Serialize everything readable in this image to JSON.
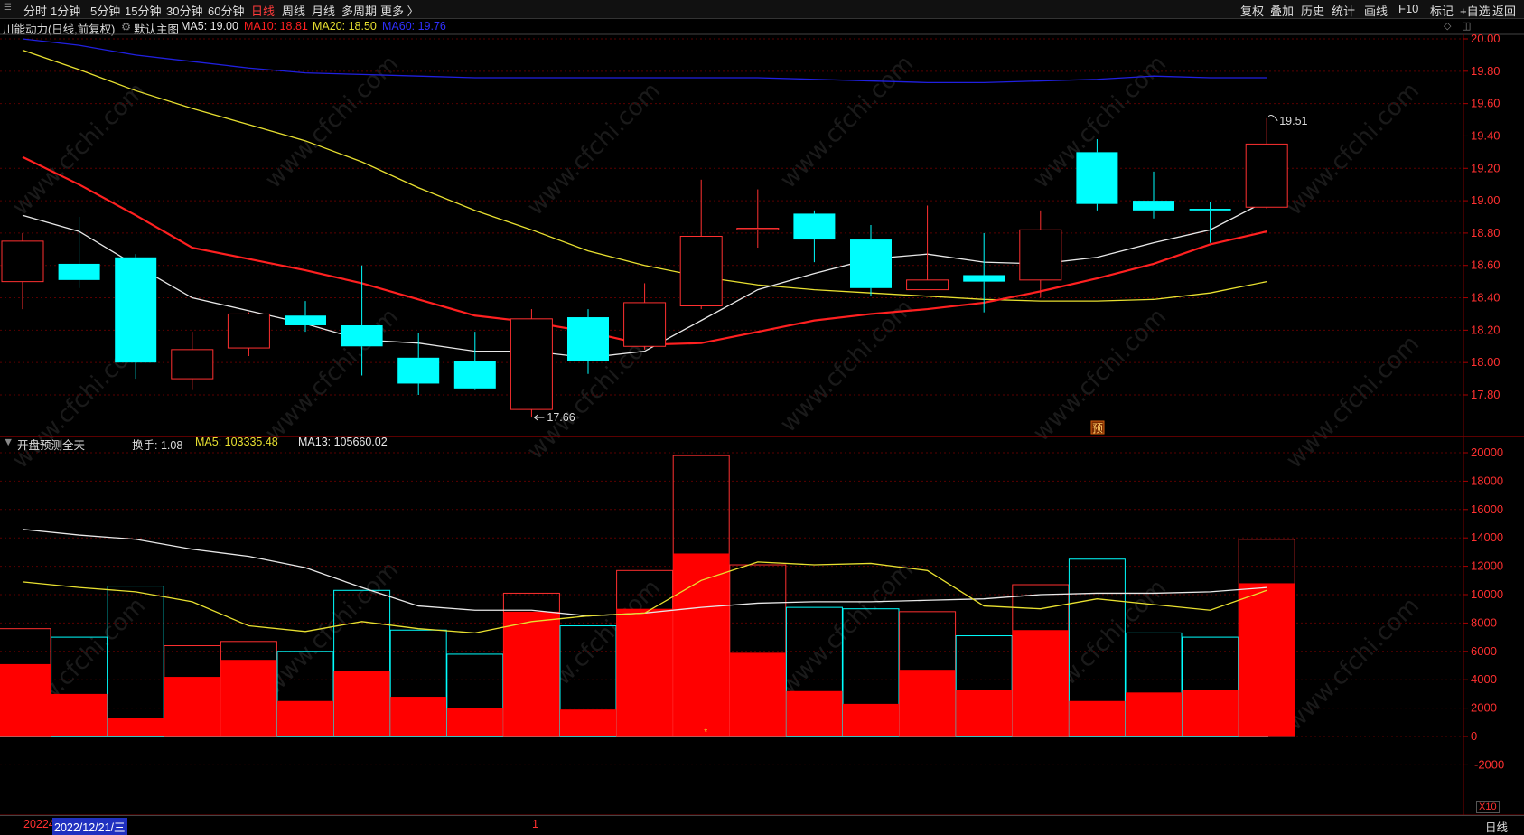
{
  "topbar": {
    "periods": [
      "分时",
      "1分钟",
      "5分钟",
      "15分钟",
      "30分钟",
      "60分钟",
      "日线",
      "周线",
      "月线",
      "多周期",
      "更多 〉"
    ],
    "active_period": "日线",
    "right_buttons": [
      "复权",
      "叠加",
      "历史",
      "统计",
      "画线",
      "F10",
      "标记",
      "+自选",
      "返回"
    ]
  },
  "price_panel": {
    "title": "川能动力(日线,前复权)",
    "main_label": "默认主图",
    "ma5": "MA5: 19.00",
    "ma10": "MA10: 18.81",
    "ma20": "MA20: 18.50",
    "ma60": "MA60: 19.76",
    "high_label": "19.51",
    "low_label": "17.66",
    "forecast_marker": "预"
  },
  "volume_panel": {
    "title": "开盘预测全天",
    "turnover": "换手: 1.08",
    "ma5": "MA5: 103335.48",
    "ma13": "MA13: 105660.02",
    "scale_label": "X10"
  },
  "bottombar": {
    "date_prefix": "20224",
    "date_selected": "2022/12/21/三",
    "marker": "1",
    "period": "日线"
  },
  "watermark": "www.cfchi.com",
  "colors": {
    "up": "#ff3030",
    "down": "#00ffff",
    "ma5": "#e8e8e8",
    "ma10": "#ff2020",
    "ma20": "#e8e030",
    "ma60": "#2020e0",
    "grid": "#5a0000"
  },
  "chart_data": [
    {
      "type": "candlestick",
      "title": "川能动力(日线,前复权)",
      "y_ticks": [
        "20.00",
        "19.80",
        "19.60",
        "19.40",
        "19.20",
        "19.00",
        "18.80",
        "18.60",
        "18.40",
        "18.20",
        "18.00",
        "17.80"
      ],
      "ylim": [
        17.6,
        20.05
      ],
      "candles": [
        {
          "o": 18.5,
          "c": 18.75,
          "h": 18.8,
          "l": 18.33
        },
        {
          "o": 18.61,
          "c": 18.51,
          "h": 18.9,
          "l": 18.46
        },
        {
          "o": 18.65,
          "c": 18.0,
          "h": 18.67,
          "l": 17.9
        },
        {
          "o": 17.9,
          "c": 18.08,
          "h": 18.19,
          "l": 17.83
        },
        {
          "o": 18.09,
          "c": 18.3,
          "h": 18.31,
          "l": 18.04
        },
        {
          "o": 18.29,
          "c": 18.23,
          "h": 18.38,
          "l": 18.19
        },
        {
          "o": 18.23,
          "c": 18.1,
          "h": 18.6,
          "l": 17.92
        },
        {
          "o": 18.03,
          "c": 17.87,
          "h": 18.18,
          "l": 17.8
        },
        {
          "o": 18.01,
          "c": 17.84,
          "h": 18.19,
          "l": 17.83
        },
        {
          "o": 17.71,
          "c": 18.27,
          "h": 18.33,
          "l": 17.66
        },
        {
          "o": 18.28,
          "c": 18.01,
          "h": 18.33,
          "l": 17.93
        },
        {
          "o": 18.1,
          "c": 18.37,
          "h": 18.49,
          "l": 18.08
        },
        {
          "o": 18.35,
          "c": 18.78,
          "h": 19.13,
          "l": 18.33
        },
        {
          "o": 18.83,
          "c": 18.83,
          "h": 19.07,
          "l": 18.71
        },
        {
          "o": 18.92,
          "c": 18.76,
          "h": 18.94,
          "l": 18.62
        },
        {
          "o": 18.76,
          "c": 18.46,
          "h": 18.85,
          "l": 18.41
        },
        {
          "o": 18.45,
          "c": 18.51,
          "h": 18.97,
          "l": 18.45
        },
        {
          "o": 18.54,
          "c": 18.5,
          "h": 18.8,
          "l": 18.31
        },
        {
          "o": 18.51,
          "c": 18.82,
          "h": 18.94,
          "l": 18.4
        },
        {
          "o": 19.3,
          "c": 18.98,
          "h": 19.38,
          "l": 18.94
        },
        {
          "o": 19.0,
          "c": 18.94,
          "h": 19.18,
          "l": 18.89
        },
        {
          "o": 18.95,
          "c": 18.94,
          "h": 18.99,
          "l": 18.74
        },
        {
          "o": 18.96,
          "c": 19.35,
          "h": 19.51,
          "l": 18.95
        }
      ],
      "ma5": [
        18.91,
        18.81,
        18.6,
        18.4,
        18.32,
        18.24,
        18.14,
        18.12,
        18.07,
        18.07,
        18.03,
        18.07,
        18.26,
        18.45,
        18.55,
        18.64,
        18.67,
        18.62,
        18.61,
        18.65,
        18.74,
        18.82,
        19.0
      ],
      "ma10": [
        19.27,
        19.1,
        18.91,
        18.71,
        18.64,
        18.57,
        18.49,
        18.39,
        18.29,
        18.25,
        18.19,
        18.11,
        18.12,
        18.19,
        18.26,
        18.3,
        18.33,
        18.37,
        18.44,
        18.52,
        18.61,
        18.73,
        18.81
      ],
      "ma20": [
        19.93,
        19.81,
        19.68,
        19.57,
        19.47,
        19.37,
        19.24,
        19.08,
        18.94,
        18.82,
        18.69,
        18.6,
        18.53,
        18.48,
        18.45,
        18.43,
        18.41,
        18.39,
        18.38,
        18.38,
        18.39,
        18.43,
        18.5
      ],
      "ma60": [
        20.0,
        19.96,
        19.9,
        19.86,
        19.82,
        19.79,
        19.78,
        19.77,
        19.76,
        19.76,
        19.76,
        19.76,
        19.76,
        19.76,
        19.75,
        19.74,
        19.73,
        19.73,
        19.74,
        19.75,
        19.77,
        19.76,
        19.76
      ]
    },
    {
      "type": "bar",
      "title": "开盘预测全天",
      "y_ticks": [
        "20000",
        "18000",
        "16000",
        "14000",
        "12000",
        "10000",
        "8000",
        "6000",
        "4000",
        "2000",
        "0",
        "-2000"
      ],
      "ylim": [
        -3000,
        20800
      ],
      "volume": [
        7600,
        7000,
        10600,
        6400,
        6700,
        6000,
        10300,
        7500,
        5800,
        10100,
        7800,
        11700,
        19800,
        12100,
        9100,
        9000,
        8800,
        7100,
        10700,
        12500,
        7300,
        7000,
        13900
      ],
      "open_forecast": [
        5100,
        3000,
        1300,
        4200,
        5400,
        2500,
        4600,
        2800,
        2000,
        8800,
        1900,
        9000,
        12900,
        5900,
        3200,
        2300,
        4700,
        3300,
        7500,
        2500,
        3100,
        3300,
        10800
      ],
      "ma5": [
        10900,
        10500,
        10200,
        9500,
        7800,
        7400,
        8100,
        7600,
        7300,
        8100,
        8500,
        8700,
        11000,
        12300,
        12100,
        12200,
        11700,
        9200,
        9000,
        9700,
        9300,
        8900,
        10300
      ],
      "ma13": [
        14600,
        14200,
        13900,
        13200,
        12700,
        11900,
        10500,
        9200,
        8900,
        8900,
        8500,
        8700,
        9100,
        9400,
        9500,
        9500,
        9600,
        9700,
        10000,
        10100,
        10100,
        10200,
        10500
      ]
    }
  ]
}
